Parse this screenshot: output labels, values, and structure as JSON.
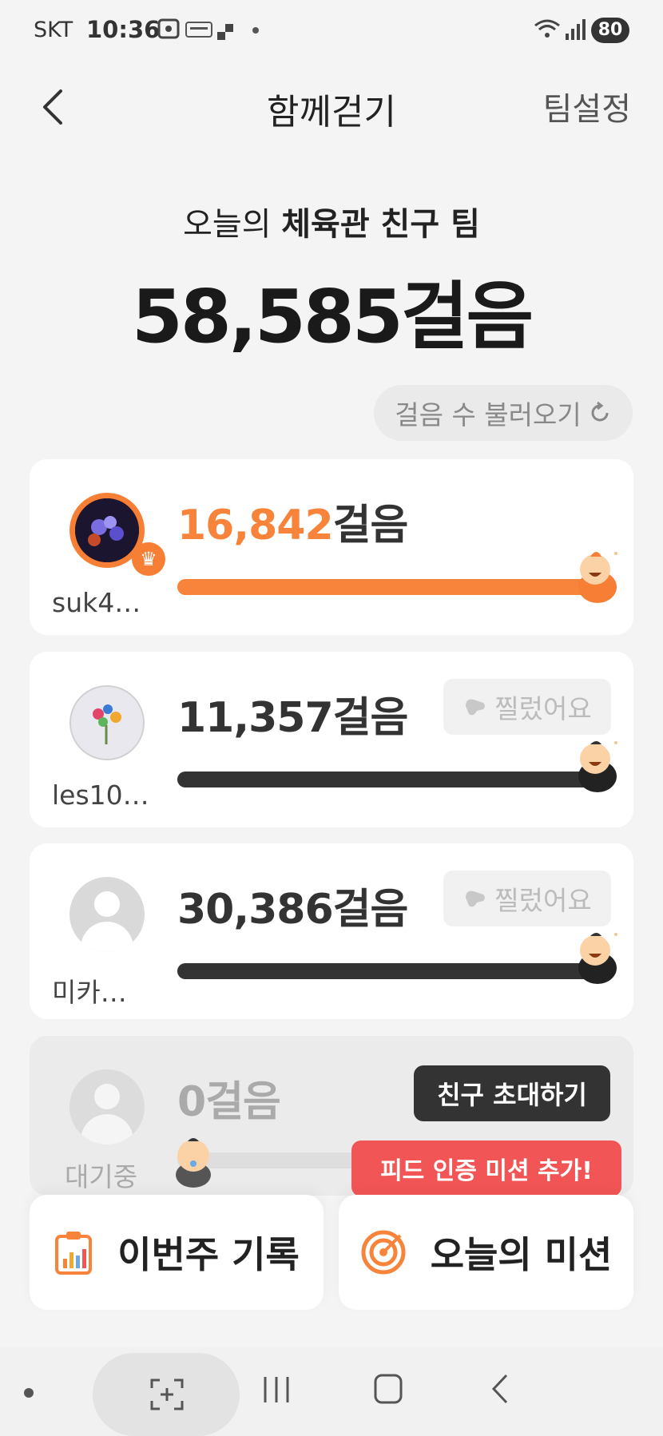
{
  "status_bar": {
    "carrier": "SKT",
    "time": "10:36",
    "battery": "80"
  },
  "header": {
    "title": "함께걷기",
    "team_settings": "팀설정"
  },
  "summary": {
    "prefix": "오늘의",
    "team_name": "체육관 친구 팀",
    "total_steps": "58,585걸음"
  },
  "refresh_label": "걸음 수 불러오기",
  "steps_unit": "걸음",
  "members": [
    {
      "name": "suk4…",
      "steps": "16,842",
      "progress": 1.0,
      "leader": true
    },
    {
      "name": "les10…",
      "steps": "11,357",
      "progress": 1.0,
      "poke_label": "찔렀어요"
    },
    {
      "name": "미카…",
      "steps": "30,386",
      "progress": 1.0,
      "poke_label": "찔렀어요"
    },
    {
      "name": "대기중",
      "steps": "0",
      "progress": 0.0
    }
  ],
  "invite_label": "친구 초대하기",
  "mission_tooltip": "피드 인증 미션 추가!",
  "actions": {
    "weekly_record": "이번주 기록",
    "today_mission": "오늘의 미션"
  },
  "colors": {
    "accent": "#f7843a",
    "dark_bar": "#333333",
    "tooltip": "#f25555"
  }
}
